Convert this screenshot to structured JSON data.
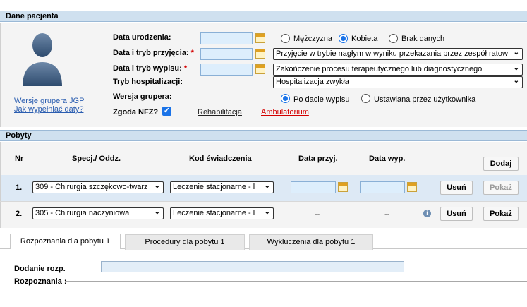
{
  "patient": {
    "header": "Dane pacjenta",
    "links": {
      "grouper_versions": "Wersje grupera JGP",
      "how_to_fill_dates": "Jak wypełniać daty?"
    },
    "birth_date_label": "Data urodzenia:",
    "admission_label": "Data i tryb przyjęcia:",
    "discharge_label": "Data i tryb wypisu:",
    "hospitalization_label": "Tryb hospitalizacji:",
    "grouper_version_label": "Wersja grupera:",
    "nfz_consent_label": "Zgoda NFZ?",
    "required_mark": "*",
    "sex_options": [
      "Mężczyzna",
      "Kobieta",
      "Brak danych"
    ],
    "sex_selected": "Kobieta",
    "admission_mode": "Przyjęcie w trybie nagłym w wyniku przekazania przez zespół ratow",
    "discharge_mode": "Zakończenie procesu terapeutycznego lub diagnostycznego",
    "hospitalization_mode": "Hospitalizacja zwykła",
    "grouper_options": [
      "Po dacie wypisu",
      "Ustawiana przez użytkownika"
    ],
    "grouper_selected": "Po dacie wypisu",
    "nfz_consent_checked": true,
    "rehab_link": "Rehabilitacja",
    "ambulatory_link": "Ambulatorium"
  },
  "stays": {
    "header": "Pobyty",
    "columns": [
      "Nr",
      "Specj./ Oddz.",
      "Kod świadczenia",
      "Data przyj.",
      "Data wyp."
    ],
    "add_button": "Dodaj",
    "rows": [
      {
        "nr": "1.",
        "dept": "309 - Chirurgia szczękowo-twarz",
        "code": "Leczenie stacjonarne - l",
        "admit": "",
        "discharge": "",
        "remove": "Usuń",
        "show": "Pokaż",
        "show_enabled": false
      },
      {
        "nr": "2.",
        "dept": "305 - Chirurgia naczyniowa",
        "code": "Leczenie stacjonarne - l",
        "admit": "--",
        "discharge": "--",
        "remove": "Usuń",
        "show": "Pokaż",
        "show_enabled": true
      }
    ]
  },
  "tabs": [
    "Rozpoznania dla pobytu 1",
    "Procedury dla pobytu 1",
    "Wykluczenia dla pobytu 1"
  ],
  "active_tab": 0,
  "diagnosis": {
    "add_label": "Dodanie rozp.",
    "list_label": "Rozpoznania :",
    "add_value": ""
  },
  "colors": {
    "header_bg": "#cfe0ef",
    "row_highlight": "#dde9f5",
    "accent": "#1a73e8",
    "required": "#d40000"
  }
}
